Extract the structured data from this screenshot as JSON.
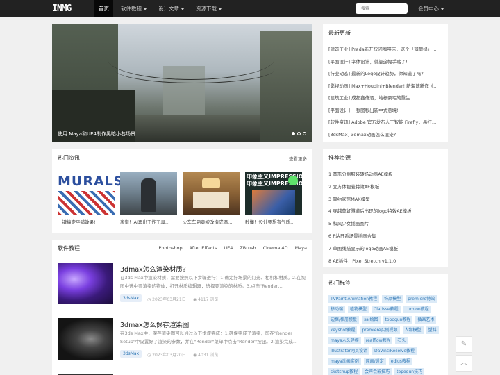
{
  "nav": {
    "logo": "INMG",
    "items": [
      "首页",
      "软件教程",
      "设计文章",
      "资源下载"
    ],
    "search_placeholder": "搜索",
    "member": "会员中心"
  },
  "hero": {
    "caption": "使用 Maya和UE4制作黑暗小巷场景"
  },
  "hot": {
    "title": "热门资讯",
    "more": "查看更多",
    "items": [
      "一键搞定平铺效果!",
      "离谱！AI再出王炸工具…",
      "火车车厢竟被改造成酒…",
      "秒懂！设计要想有气质…"
    ],
    "thumb1_text": "MURALS",
    "thumb4_text1": "印象主义IMPRESSIONISM",
    "thumb4_text2": "印象主义IMPRESSIONISM"
  },
  "tutorials": {
    "title": "软件教程",
    "tabs": [
      "Photoshop",
      "After Effects",
      "UE4",
      "ZBrush",
      "Cinema 4D",
      "Maya"
    ],
    "articles": [
      {
        "title": "3dmax怎么渲染材质?",
        "desc": "在3ds Max中渲染材质，需要按照以下步骤进行：1.确定好场景的灯光、相机和材质。2.在视图中选中要渲染的物体，打开材质编辑器，选择要渲染的材质。3.点击\"Render…",
        "tag": "3dsMax",
        "date": "2023年03月21日",
        "views": "4117 浏览"
      },
      {
        "title": "3dmax怎么保存渲染图",
        "desc": "在3ds Max中，保存渲染图可以通过以下步骤完成：1.确保完成了渲染，即在\"Render Setup\"中设置好了渲染的参数，并在\"Render\"菜单中点击\"Render\"按钮。2.渲染完成…",
        "tag": "3dsMax",
        "date": "2023年03月20日",
        "views": "4031 浏览"
      }
    ]
  },
  "latest": {
    "title": "最新更新",
    "items": [
      "[建筑工业] Prada新开快闪咖啡店，这个「薄荷绿」…",
      "[平面设计] 字体设计，就靠这幅手贴了!",
      "[行业动态] 最新的Logo设计趋势，你知道了吗?",
      "[影视动画] Max+Houdini+Blender! 新海诚新作《…",
      "[建筑工业] 成都鑫倍酒，地标豪宅的重生",
      "[平面设计] 一张图秒出新中式意境!",
      "[软件资讯] Adobe 官方发布人工智能 Firefly，吊打…",
      "[3dsMax] 3dmax动画怎么渲染?"
    ]
  },
  "recommend": {
    "title": "推荐资源",
    "items": [
      "1  圆形分割服装转场动画AE模板",
      "2  立方体视差特效AE模板",
      "3  简约家居MAX模型",
      "4  穿越莫虹隧道后出现的logo特效AE模板",
      "5  和风少女插画图片",
      "6  P站日系场景插画合集",
      "7  草图线描显示的logo动画AE模板",
      "8  AE插件：Pixel Stretch v1.1.0"
    ]
  },
  "tags": {
    "title": "热门标签",
    "items": [
      "TVPaint Animation教程",
      "饰品模型",
      "premiere特效",
      "移动端",
      "植物模型",
      "Clarisse教程",
      "Lumion教程",
      "边框/相册模板",
      "sai绘图",
      "topogun教程",
      "插画艺术",
      "keyshot教程",
      "premiere实例视频",
      "人物模型",
      "塑料",
      "maya人头建模",
      "realflow教程",
      "石头",
      "Illustrator网页设计",
      "DaVinciResolve教程",
      "maya动画实例",
      "原画/设定",
      "edius教程",
      "sketchup教程",
      "会声会影技巧",
      "topogun技巧"
    ]
  },
  "float": {
    "edit_glyph": "✎",
    "top_glyph": "︿"
  }
}
